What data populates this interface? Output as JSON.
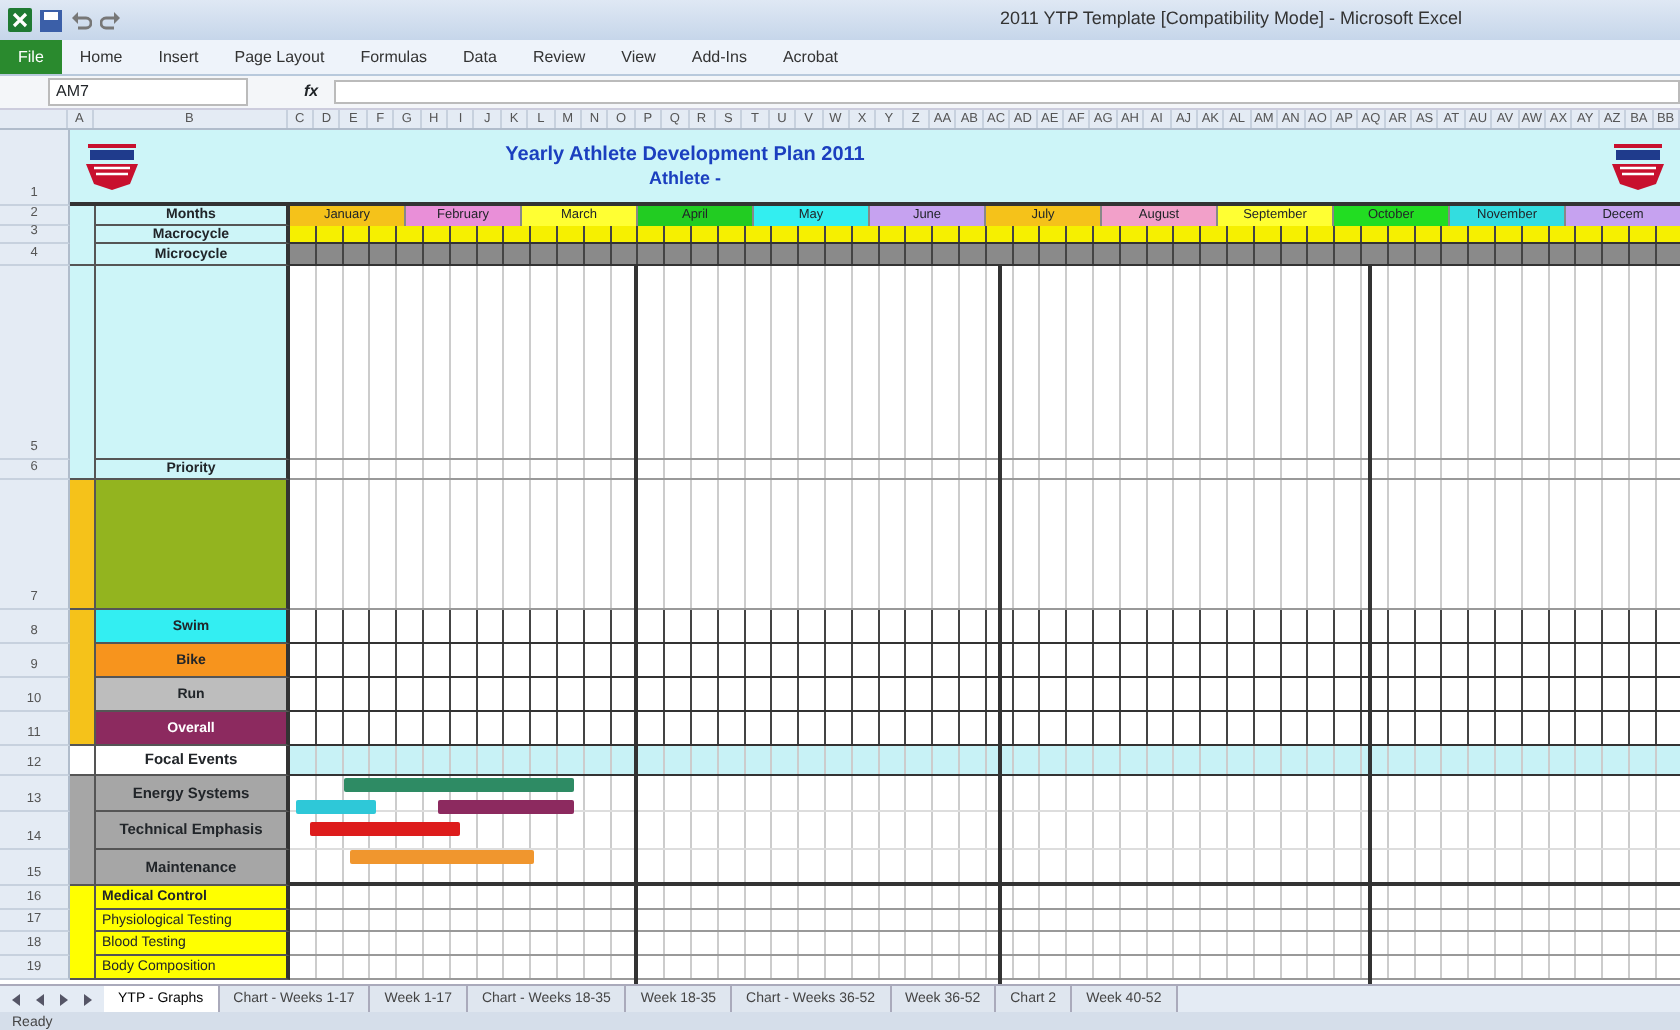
{
  "window": {
    "title": "2011 YTP Template [Compatibility Mode] - Microsoft Excel"
  },
  "ribbon": {
    "tabs": [
      {
        "label": "File",
        "selected": true
      },
      {
        "label": "Home",
        "selected": false
      },
      {
        "label": "Insert",
        "selected": false
      },
      {
        "label": "Page Layout",
        "selected": false
      },
      {
        "label": "Formulas",
        "selected": false
      },
      {
        "label": "Data",
        "selected": false
      },
      {
        "label": "Review",
        "selected": false
      },
      {
        "label": "View",
        "selected": false
      },
      {
        "label": "Add-Ins",
        "selected": false
      },
      {
        "label": "Acrobat",
        "selected": false
      }
    ]
  },
  "formula_bar": {
    "name_box": "AM7",
    "function_label": "fx"
  },
  "sheet": {
    "columns": [
      "A",
      "B",
      "C",
      "D",
      "E",
      "F",
      "G",
      "H",
      "I",
      "J",
      "K",
      "L",
      "M",
      "N",
      "O",
      "P",
      "Q",
      "R",
      "S",
      "T",
      "U",
      "V",
      "W",
      "X",
      "Y",
      "Z",
      "AA",
      "AB",
      "AC",
      "AD",
      "AE",
      "AF",
      "AG",
      "AH",
      "AI",
      "AJ",
      "AK",
      "AL",
      "AM",
      "AN",
      "AO",
      "AP",
      "AQ",
      "AR",
      "AS",
      "AT",
      "AU",
      "AV",
      "AW",
      "AX",
      "AY",
      "AZ",
      "BA",
      "BB"
    ],
    "title": "Yearly Athlete Development Plan 2011",
    "subtitle": "Athlete -",
    "months": [
      {
        "label": "January",
        "color": "#f5c21a"
      },
      {
        "label": "February",
        "color": "#e98fd8"
      },
      {
        "label": "March",
        "color": "#ffff33"
      },
      {
        "label": "April",
        "color": "#22cc22"
      },
      {
        "label": "May",
        "color": "#33eef0"
      },
      {
        "label": "June",
        "color": "#c6a2f0"
      },
      {
        "label": "July",
        "color": "#f5c21a"
      },
      {
        "label": "August",
        "color": "#f2a0c9"
      },
      {
        "label": "September",
        "color": "#ffff33"
      },
      {
        "label": "October",
        "color": "#22dd22"
      },
      {
        "label": "November",
        "color": "#33dde0"
      },
      {
        "label": "Decem",
        "color": "#c6a2f0"
      }
    ],
    "rows": [
      {
        "number": "1",
        "kind": "title"
      },
      {
        "number": "2",
        "label": "Months",
        "kind": "months"
      },
      {
        "number": "3",
        "label": "Macrocycle",
        "kind": "weeks"
      },
      {
        "number": "4",
        "label": "Microcycle",
        "kind": "micro"
      },
      {
        "number": "5",
        "kind": "tall"
      },
      {
        "number": "6",
        "label": "Priority",
        "kind": "plain"
      },
      {
        "number": "7",
        "kind": "block",
        "color": "#93b41f"
      },
      {
        "number": "8",
        "label": "Swim",
        "kind": "sport",
        "color": "#33eef2"
      },
      {
        "number": "9",
        "label": "Bike",
        "kind": "sport",
        "color": "#f7941d"
      },
      {
        "number": "10",
        "label": "Run",
        "kind": "sport",
        "color": "#bdbdbd"
      },
      {
        "number": "11",
        "label": "Overall",
        "kind": "sport",
        "color": "#8c2a5f"
      },
      {
        "number": "12",
        "label": "Focal Events",
        "kind": "focal"
      },
      {
        "number": "13",
        "label": "Energy Systems",
        "kind": "bars",
        "color": "#a6a6a6"
      },
      {
        "number": "14",
        "label": "Technical Emphasis",
        "kind": "bars",
        "color": "#a6a6a6"
      },
      {
        "number": "15",
        "label": "Maintenance",
        "kind": "bars",
        "color": "#a6a6a6"
      },
      {
        "number": "16",
        "label": "Medical Control",
        "kind": "medical",
        "color": "#ffff00"
      },
      {
        "number": "17",
        "label": "Physiological Testing",
        "kind": "medical",
        "color": "#ffff00"
      },
      {
        "number": "18",
        "label": "Blood Testing",
        "kind": "medical",
        "color": "#ffff00"
      },
      {
        "number": "19",
        "label": "Body Composition",
        "kind": "medical",
        "color": "#ffff00"
      }
    ],
    "training_bars": [
      {
        "color": "#2e8b64"
      },
      {
        "color": "#2ec8d8"
      },
      {
        "color": "#8c2a5f"
      },
      {
        "color": "#dd1c1c"
      },
      {
        "color": "#f0962e"
      }
    ]
  },
  "sheet_tabs": [
    {
      "label": "YTP - Graphs",
      "selected": true
    },
    {
      "label": "Chart - Weeks 1-17",
      "selected": false
    },
    {
      "label": "Week 1-17",
      "selected": false
    },
    {
      "label": "Chart - Weeks 18-35",
      "selected": false
    },
    {
      "label": "Week 18-35",
      "selected": false
    },
    {
      "label": "Chart - Weeks 36-52",
      "selected": false
    },
    {
      "label": "Week 36-52",
      "selected": false
    },
    {
      "label": "Chart 2",
      "selected": false
    },
    {
      "label": "Week 40-52",
      "selected": false
    }
  ],
  "status_bar": "Ready"
}
